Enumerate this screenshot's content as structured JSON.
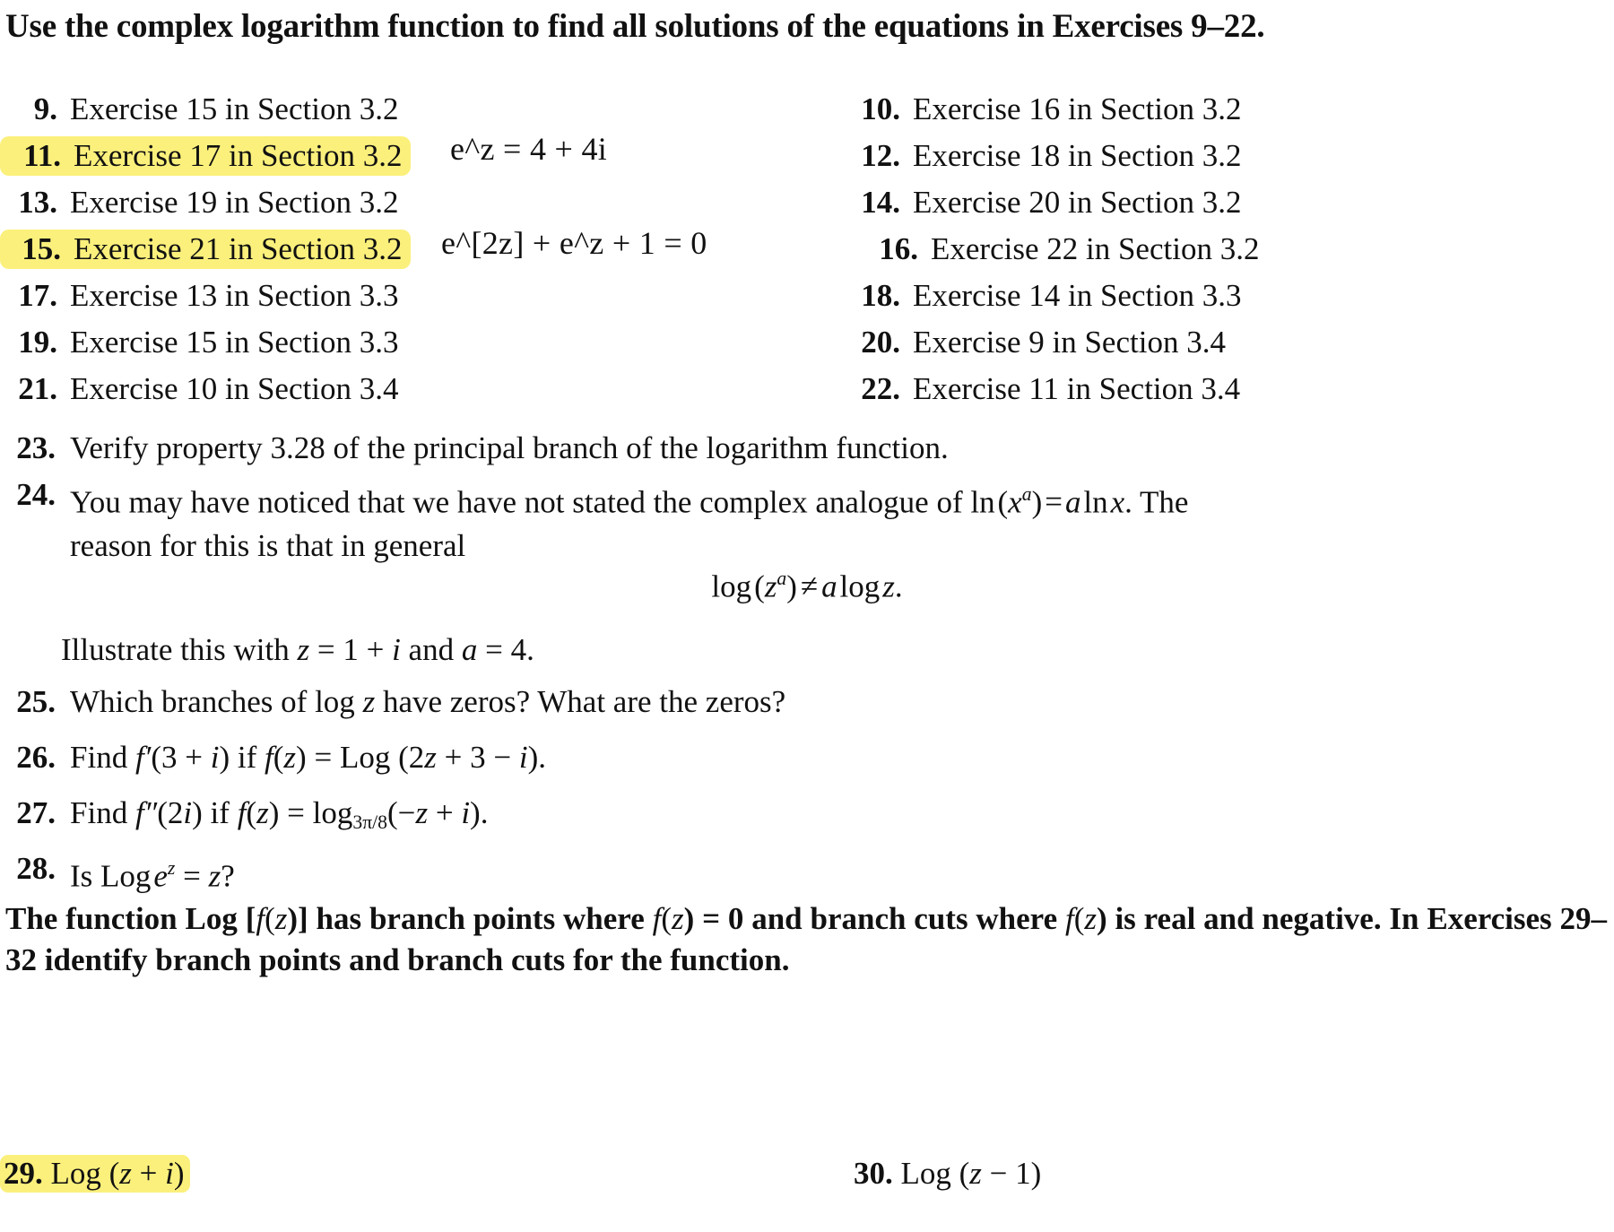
{
  "page": {
    "intro": "Use the complex logarithm function to find all solutions of the equations in Exercises 9–22.",
    "highlight_color": "#fbf07c"
  },
  "exercise_list": {
    "rows": [
      {
        "left": {
          "num": "9.",
          "text": "Exercise 15 in Section 3.2",
          "highlighted": false
        },
        "right": {
          "num": "10.",
          "text": "Exercise 16 in Section 3.2",
          "highlighted": false
        }
      },
      {
        "left": {
          "num": "11.",
          "text": "Exercise 17 in Section 3.2",
          "highlighted": true
        },
        "right": {
          "num": "12.",
          "text": "Exercise 18 in Section 3.2",
          "highlighted": false
        }
      },
      {
        "left": {
          "num": "13.",
          "text": "Exercise 19 in Section 3.2",
          "highlighted": false
        },
        "right": {
          "num": "14.",
          "text": "Exercise 20 in Section 3.2",
          "highlighted": false
        }
      },
      {
        "left": {
          "num": "15.",
          "text": "Exercise 21 in Section 3.2",
          "highlighted": true
        },
        "right": {
          "num": "16.",
          "text": "Exercise 22 in Section 3.2",
          "highlighted": false
        }
      },
      {
        "left": {
          "num": "17.",
          "text": "Exercise 13 in Section 3.3",
          "highlighted": false
        },
        "right": {
          "num": "18.",
          "text": "Exercise 14 in Section 3.3",
          "highlighted": false
        }
      },
      {
        "left": {
          "num": "19.",
          "text": "Exercise 15 in Section 3.3",
          "highlighted": false
        },
        "right": {
          "num": "20.",
          "text": "Exercise 9 in Section 3.4",
          "highlighted": false
        }
      },
      {
        "left": {
          "num": "21.",
          "text": "Exercise 10 in Section 3.4",
          "highlighted": false
        },
        "right": {
          "num": "22.",
          "text": "Exercise 11 in Section 3.4",
          "highlighted": false
        }
      }
    ]
  },
  "annotations": [
    {
      "id": "annotation-exercise-11",
      "text": "e^z = 4 + 4i"
    },
    {
      "id": "annotation-exercise-15",
      "text": "e^[2z] + e^z + 1 = 0"
    }
  ],
  "items": {
    "ex23": {
      "num": "23.",
      "text": "Verify property 3.28 of the principal branch of the logarithm function."
    },
    "ex24": {
      "num": "24.",
      "line1_a": "You may have noticed that we have not stated the complex analogue of ",
      "line1_math_fn": "ln",
      "line1_math_arg_base": "x",
      "line1_math_arg_exp": "a",
      "line1_math_eq": "=",
      "line1_math_rhs_a": "a",
      "line1_math_rhs_ln": "ln",
      "line1_math_rhs_x": "x",
      "line1_b": ".  The",
      "line2": "reason for this is that in general",
      "display_eq": {
        "lhs_fn": "log",
        "lhs_base": "z",
        "lhs_exp": "a",
        "rel": "≠",
        "rhs_coef": "a",
        "rhs_fn": "log",
        "rhs_arg": "z",
        "period": "."
      },
      "illustrate": {
        "prefix": "Illustrate this with ",
        "z_var": "z",
        "z_eq": "= 1 + ",
        "i_var": "i",
        "mid": " and ",
        "a_var": "a",
        "a_eq": "= 4."
      }
    },
    "ex25": {
      "num": "25.",
      "prefix": "Which branches of log ",
      "var": "z",
      "suffix": " have zeros? What are the zeros?"
    },
    "ex26": {
      "num": "26.",
      "text_find": "Find ",
      "fprime": "f′",
      "arg1": "(3 + ",
      "i1": "i",
      "arg1b": ") if ",
      "f2": "f",
      "arg2": "(",
      "z2": "z",
      "arg2b": ") = ",
      "logcap": "Log",
      "arg3": " (2",
      "z3": "z",
      "arg3b": " + 3 − ",
      "i3": "i",
      "arg3c": ")."
    },
    "ex27": {
      "num": "27.",
      "text_find": "Find ",
      "fdprime": "f″",
      "arg1": "(2",
      "i1": "i",
      "arg1b": ") if ",
      "f2": "f",
      "arg2": "(",
      "z2": "z",
      "arg2b": ") = ",
      "logbase": "log",
      "sub": "3π/8",
      "arg3": "(−",
      "z3": "z",
      "arg3b": " + ",
      "i3": "i",
      "arg3c": ")."
    },
    "ex28": {
      "num": "28.",
      "prefix": "Is ",
      "logcap": "Log",
      "e": "e",
      "exp": "z",
      "eq": " = ",
      "z": "z",
      "q": "?"
    }
  },
  "block_paragraph": {
    "a": "The function ",
    "logcap": "Log",
    "b": " [",
    "f1": "f",
    "c": "(",
    "z1": "z",
    "d": ")] has branch points where ",
    "f2": "f",
    "e": "(",
    "z2": "z",
    "g": ") = 0 and branch cuts where ",
    "f3": "f",
    "h": "(",
    "z3": "z",
    "i": ") is real and negative.  In Exercises 29–32 identify branch points and branch cuts for the function."
  },
  "bottom_row": {
    "left": {
      "num": "29.",
      "logcap": "Log",
      "open": " (",
      "z": "z",
      "op": " + ",
      "i": "i",
      "close": ")",
      "highlighted": true
    },
    "right": {
      "num": "30.",
      "logcap": "Log",
      "open": " (",
      "z": "z",
      "op": " − ",
      "one": "1",
      "close": ")",
      "highlighted": false
    }
  }
}
